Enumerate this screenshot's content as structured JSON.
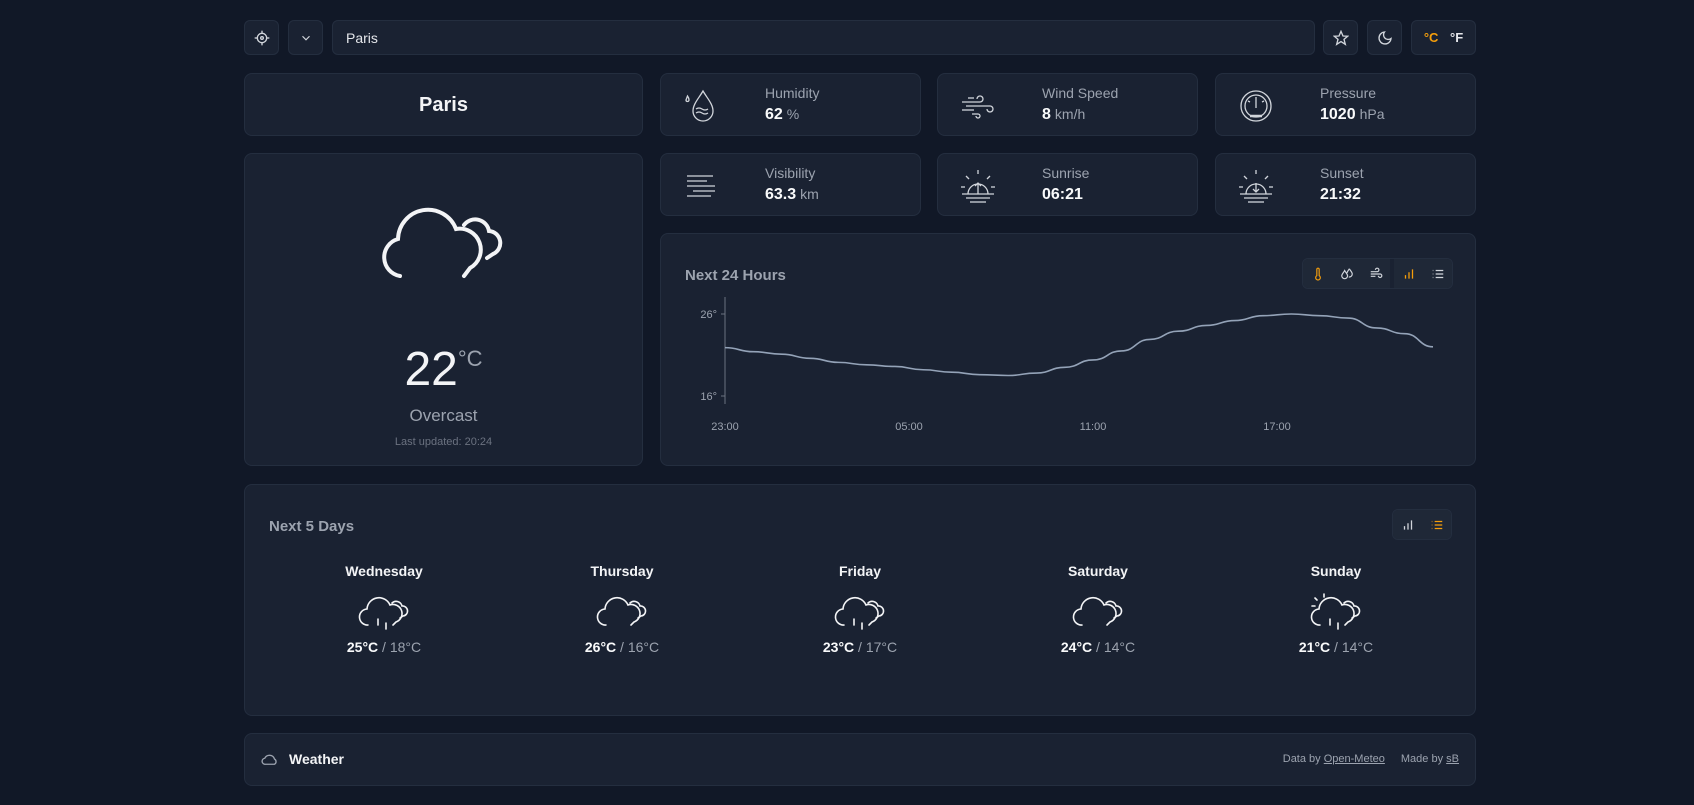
{
  "search": {
    "value": "Paris"
  },
  "units": {
    "celsius": "°C",
    "fahrenheit": "°F"
  },
  "current": {
    "city": "Paris",
    "temperature": "22",
    "temperature_unit": "°C",
    "condition": "Overcast",
    "last_updated": "Last updated: 20:24",
    "icon": "cloud-icon"
  },
  "stats": [
    {
      "label": "Humidity",
      "value": "62",
      "unit": "%",
      "icon": "humidity-icon"
    },
    {
      "label": "Wind Speed",
      "value": "8",
      "unit": "km/h",
      "icon": "wind-icon"
    },
    {
      "label": "Pressure",
      "value": "1020",
      "unit": "hPa",
      "icon": "pressure-gauge-icon"
    },
    {
      "label": "Visibility",
      "value": "63.3",
      "unit": "km",
      "icon": "fog-icon"
    },
    {
      "label": "Sunrise",
      "value": "06:21",
      "unit": "",
      "icon": "sunrise-icon"
    },
    {
      "label": "Sunset",
      "value": "21:32",
      "unit": "",
      "icon": "sunset-icon"
    }
  ],
  "hourly": {
    "title": "Next 24 Hours",
    "active_metric": "temperature",
    "active_view": "chart"
  },
  "chart_data": {
    "type": "line",
    "title": "Next 24 Hours",
    "x": [
      "23:00",
      "00:00",
      "01:00",
      "02:00",
      "03:00",
      "04:00",
      "05:00",
      "06:00",
      "07:00",
      "08:00",
      "09:00",
      "10:00",
      "11:00",
      "12:00",
      "13:00",
      "14:00",
      "15:00",
      "16:00",
      "17:00",
      "18:00",
      "19:00",
      "20:00",
      "21:00",
      "22:00"
    ],
    "series": [
      {
        "values": [
          21.9,
          21.4,
          21.1,
          20.6,
          20.1,
          19.8,
          19.6,
          19.2,
          18.9,
          18.6,
          18.5,
          18.8,
          19.5,
          20.4,
          21.5,
          22.9,
          23.9,
          24.6,
          25.2,
          25.8,
          26.0,
          25.8,
          25.5,
          24.3,
          23.6,
          22.0
        ]
      }
    ],
    "xticks": [
      "23:00",
      "05:00",
      "11:00",
      "17:00"
    ],
    "yticks": [
      "26°",
      "16°"
    ],
    "ylim": [
      16,
      26
    ],
    "grid": false
  },
  "daily": {
    "title": "Next 5 Days",
    "active_view": "list",
    "days": [
      {
        "name": "Wednesday",
        "high": "25°C",
        "low": "18°C",
        "icon": "cloud-drizzle-icon"
      },
      {
        "name": "Thursday",
        "high": "26°C",
        "low": "16°C",
        "icon": "cloud-icon"
      },
      {
        "name": "Friday",
        "high": "23°C",
        "low": "17°C",
        "icon": "cloud-drizzle-icon"
      },
      {
        "name": "Saturday",
        "high": "24°C",
        "low": "14°C",
        "icon": "cloud-icon"
      },
      {
        "name": "Sunday",
        "high": "21°C",
        "low": "14°C",
        "icon": "sun-cloud-drizzle-icon"
      }
    ]
  },
  "footer": {
    "brand": "Weather",
    "data_by_prefix": "Data by",
    "data_by_link": "Open-Meteo",
    "made_by_prefix": "Made by",
    "made_by_link": "sB"
  },
  "colors": {
    "accent": "#f59e0b",
    "background": "#111827",
    "card": "#1a2232",
    "line": "#94a3b8"
  }
}
